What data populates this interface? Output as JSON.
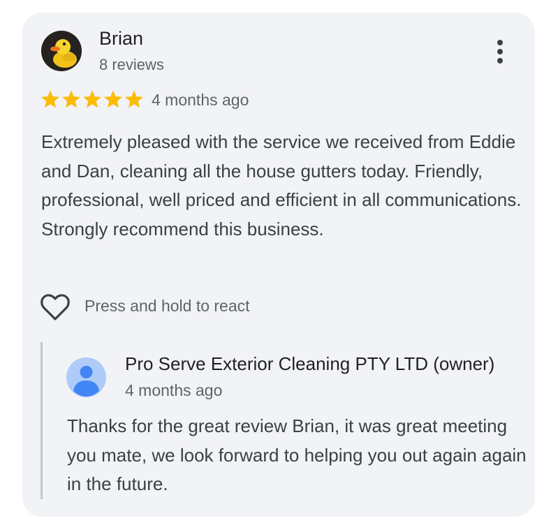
{
  "review": {
    "reviewer_name": "Brian",
    "review_count": "8 reviews",
    "rating": 5,
    "rating_max": 5,
    "time_ago": "4 months ago",
    "text": "Extremely pleased with the service we received from Eddie and Dan, cleaning all the house gutters today. Friendly, professional, well priced and efficient in all communications. Strongly recommend this business.",
    "react_label": "Press and hold to react",
    "avatar_icon": "duck-avatar",
    "more_icon": "more-vert-icon",
    "react_icon": "heart-outline-icon"
  },
  "reply": {
    "owner_name": "Pro Serve Exterior Cleaning PTY LTD (owner)",
    "time_ago": "4 months ago",
    "text": "Thanks for the great review Brian, it was great meeting you mate, we look forward to helping you out again again in the future.",
    "avatar_icon": "person-avatar-icon"
  },
  "colors": {
    "card_background": "#f2f3f6",
    "star": "#fbbc04",
    "primary_text": "#202124",
    "secondary_text": "#5f6368",
    "body_text": "#3c4043",
    "reply_bar": "#c4c7c5",
    "owner_avatar_bg": "#aecbfa",
    "owner_avatar_fg": "#4285f4"
  }
}
